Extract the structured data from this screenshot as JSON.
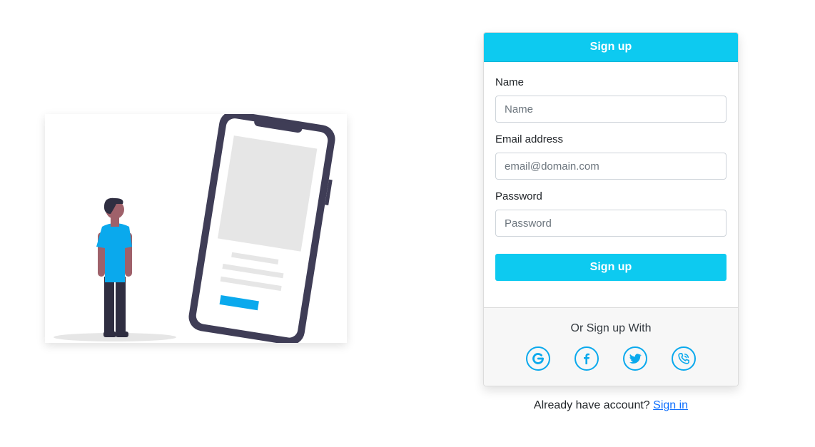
{
  "card": {
    "header_title": "Sign up",
    "fields": [
      {
        "label": "Name",
        "placeholder": "Name"
      },
      {
        "label": "Email address",
        "placeholder": "email@domain.com"
      },
      {
        "label": "Password",
        "placeholder": "Password"
      }
    ],
    "submit_label": "Sign up"
  },
  "footer": {
    "alt_text": "Or Sign up With",
    "social_icons": [
      "google-icon",
      "facebook-icon",
      "twitter-icon",
      "phone-icon"
    ]
  },
  "signin": {
    "prompt": "Already have account?",
    "link_label": "Sign in"
  },
  "colors": {
    "accent": "#0dcaf0",
    "social_icon": "#0aa9ed",
    "link": "#0d6efd"
  }
}
